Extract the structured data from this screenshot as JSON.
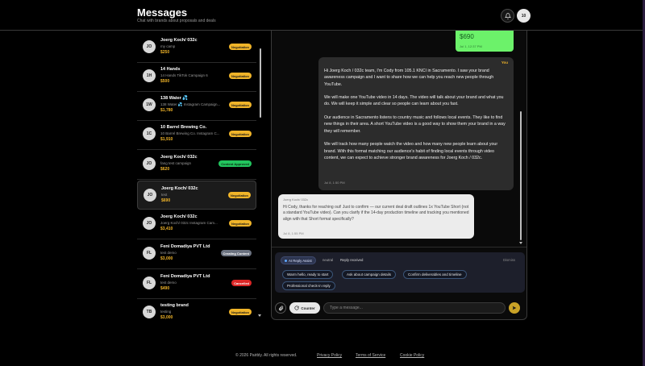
{
  "header": {
    "title": "Messages",
    "subtitle": "Chat with brands about proposals and deals",
    "user_initials": "10"
  },
  "conversations": [
    {
      "initials": "JO",
      "name": "Joerg Koch/ 032c",
      "subtitle": "my camp",
      "price": "$250",
      "badge": "Negotiation",
      "badge_color": "#f0b429",
      "badge_text_color": "#1a1a1a"
    },
    {
      "initials": "1H",
      "name": "14 Hands",
      "subtitle": "14 Hands TikTok Campaign 6",
      "price": "$500",
      "badge": "Negotiation",
      "badge_color": "#f0b429",
      "badge_text_color": "#1a1a1a"
    },
    {
      "initials": "1W",
      "name": "138 Water 💦",
      "subtitle": "138 Water 💦 Instagram Campaign...",
      "price": "$1,780",
      "badge": "Negotiation",
      "badge_color": "#f0b429",
      "badge_text_color": "#1a1a1a"
    },
    {
      "initials": "1C",
      "name": "10 Barrel Brewing Co.",
      "subtitle": "10 Barrel Brewing Co. Instagram C...",
      "price": "$1,910",
      "badge": "Negotiation",
      "badge_color": "#f0b429",
      "badge_text_color": "#1a1a1a"
    },
    {
      "initials": "JO",
      "name": "Joerg Koch/ 032c",
      "subtitle": "fang test campaign",
      "price": "$620",
      "badge": "Content Approved",
      "badge_color": "#22c55e",
      "badge_text_color": "#0b2a12"
    },
    {
      "initials": "JO",
      "name": "Joerg Koch/ 032c",
      "subtitle": "test",
      "price": "$690",
      "badge": "Negotiation",
      "badge_color": "#f0b429",
      "badge_text_color": "#1a1a1a",
      "active": true
    },
    {
      "initials": "JO",
      "name": "Joerg Koch/ 032c",
      "subtitle": "Joerg Koch/ 032c Instagram Cam...",
      "price": "$3,410",
      "badge": "Negotiation",
      "badge_color": "#f0b429",
      "badge_text_color": "#1a1a1a"
    },
    {
      "initials": "FL",
      "name": "Feni Domadiya PVT Ltd",
      "subtitle": "test demo",
      "price": "$3,000",
      "badge": "Creating Content",
      "badge_color": "#6b7280",
      "badge_text_color": "#ffffff"
    },
    {
      "initials": "FL",
      "name": "Feni Domadiya PVT Ltd",
      "subtitle": "test demo",
      "price": "$490",
      "badge": "Cancelled",
      "badge_color": "#dc2626",
      "badge_text_color": "#ffffff"
    },
    {
      "initials": "TB",
      "name": "testing brand",
      "subtitle": "testing",
      "price": "$3,000",
      "badge": "Negotiation",
      "badge_color": "#f0b429",
      "badge_text_color": "#1a1a1a"
    }
  ],
  "chat": {
    "top_bubble": {
      "amount": "$690",
      "time": "Jul 1, 12:37 PM"
    },
    "you_message": {
      "sender": "You",
      "text": "Hi Joerg Koch / 032c team, I'm Cody from 105.1 KNCI in Sacramento. I saw your brand awareness campaign and I want to share how we can help you reach new people through YouTube.\n\nWe will make one YouTube video in 14 days. The video will talk about your brand and what you do. We will keep it simple and clear so people can learn about you fast.\n\nOur audience in Sacramento listens to country music and follows local events. They like to find new things in their area. A short YouTube video is a good way to show them your brand in a way they will remember.\n\nWe will track how many people watch the video and how many new people learn about your brand. With this format matching our audience's habit of finding local events through video content, we can expect to achieve stronger brand awareness for Joerg Koch / 032c.",
      "time": "Jul 8, 1:50 PM"
    },
    "brand_message": {
      "sender": "Joerg Koch/ 032c",
      "text": "Hi Cody, thanks for reaching out! Just to confirm — our current deal draft outlines 1x YouTube Short (not a standard YouTube video). Can you clarify if the 14-day production timeline and tracking you mentioned align with that Short format specifically?",
      "time": "Jul 8, 1:55 PM"
    }
  },
  "assist": {
    "label": "AI Reply Assist",
    "tone": "neutral",
    "status": "Reply received",
    "dismiss": "Dismiss",
    "chips": [
      "Warm hello, ready to start",
      "Ask about campaign details",
      "Confirm deliverables and timeline",
      "Professional check-in reply"
    ]
  },
  "composer": {
    "counter_label": "Counter",
    "placeholder": "Type a message..."
  },
  "footer": {
    "copyright": "© 2026 Pairbly. All rights reserved.",
    "privacy": "Privacy Policy",
    "terms": "Terms of Service",
    "cookie": "Cookie Policy"
  },
  "colors": {
    "accent": "#f0b429",
    "outgoing_bubble": "#6cf26a",
    "send_button": "#c9a227"
  }
}
